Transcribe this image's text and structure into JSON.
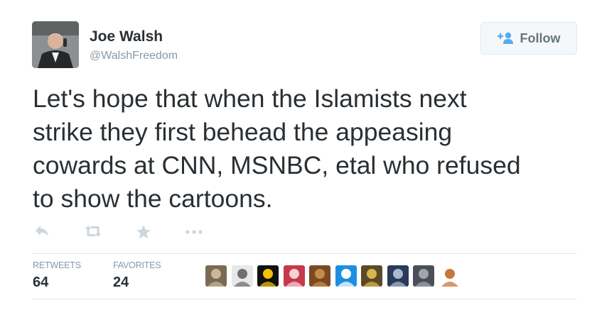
{
  "user": {
    "name": "Joe Walsh",
    "handle": "@WalshFreedom"
  },
  "follow_button": {
    "label": "Follow",
    "icon": "add-person-icon",
    "accent": "#55acee"
  },
  "tweet": {
    "lines": [
      "Let's hope that when the Islamists next",
      "strike they first behead the appeasing",
      "cowards at CNN, MSNBC, etal who refused",
      "to show the cartoons."
    ]
  },
  "actions": [
    {
      "name": "reply-icon"
    },
    {
      "name": "retweet-icon"
    },
    {
      "name": "favorite-icon"
    },
    {
      "name": "more-icon"
    }
  ],
  "stats": {
    "retweets_label": "RETWEETS",
    "retweets_value": "64",
    "favorites_label": "FAVORITES",
    "favorites_value": "24"
  },
  "favoriters": [
    {
      "name": "favoriter-avatar-1",
      "bg": "#7a6a55",
      "fg": "#c9b79a"
    },
    {
      "name": "favoriter-avatar-2",
      "bg": "#e8e8e8",
      "fg": "#6f6f6f"
    },
    {
      "name": "favoriter-avatar-3",
      "bg": "#111111",
      "fg": "#f2c200"
    },
    {
      "name": "favoriter-avatar-4",
      "bg": "#c53a4a",
      "fg": "#f4d2d6"
    },
    {
      "name": "favoriter-avatar-5",
      "bg": "#7a4a22",
      "fg": "#c58a4e"
    },
    {
      "name": "favoriter-avatar-6",
      "bg": "#1d8fe0",
      "fg": "#ffffff"
    },
    {
      "name": "favoriter-avatar-7",
      "bg": "#5a4a2a",
      "fg": "#d9b64a"
    },
    {
      "name": "favoriter-avatar-8",
      "bg": "#2a3b5a",
      "fg": "#a9b8cf"
    },
    {
      "name": "favoriter-avatar-9",
      "bg": "#4d4f57",
      "fg": "#9fa6ad"
    },
    {
      "name": "favoriter-avatar-10",
      "bg": "#ffffff",
      "fg": "#c9763a"
    }
  ]
}
